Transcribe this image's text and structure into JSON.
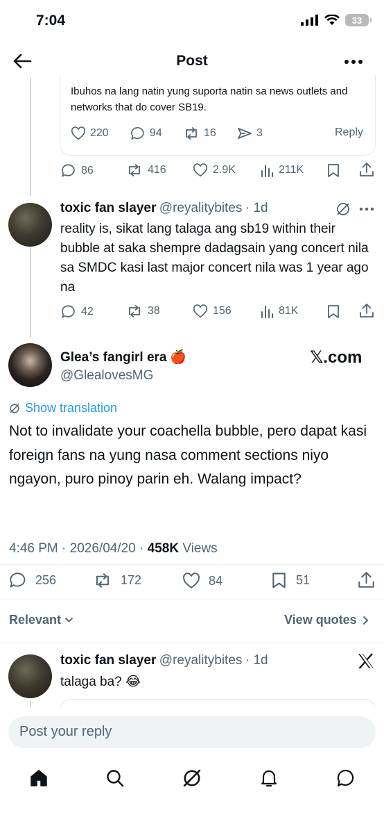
{
  "status_bar": {
    "time": "7:04",
    "battery": "33"
  },
  "header": {
    "title": "Post"
  },
  "quoted_post": {
    "text": "Ibuhos na lang natin yung suporta natin sa news outlets and networks that do cover SB19.",
    "likes": "220",
    "replies": "94",
    "reposts": "16",
    "shares": "3",
    "reply_label": "Reply"
  },
  "parent_post": {
    "replies": "86",
    "reposts": "416",
    "likes": "2.9K",
    "views": "211K"
  },
  "reply_post": {
    "name": "toxic fan slayer",
    "handle": "@reyalitybites",
    "time": "· 1d",
    "text": "reality is, sikat lang talaga ang sb19 within their bubble at saka shempre dadagsain yang concert nila sa SMDC kasi last major concert nila was 1 year ago na",
    "replies": "42",
    "reposts": "38",
    "likes": "156",
    "views": "81K"
  },
  "main_post": {
    "name": "Glea’s fangirl era",
    "emoji": "🍎",
    "handle": "@GlealovesMG",
    "watermark": "𝕏.com",
    "show_translation": "Show translation",
    "text": "Not to invalidate your coachella bubble, pero dapat kasi foreign fans na yung nasa comment sections niyo ngayon, puro pinoy parin eh. Walang impact?",
    "timestamp": "4:46 PM · 2026/04/20 · ",
    "views_count": "458K",
    "views_label": " Views",
    "replies": "256",
    "reposts": "172",
    "likes": "84",
    "bookmarks": "51"
  },
  "sort": {
    "label": "Relevant",
    "view_quotes": "View quotes"
  },
  "bottom_reply": {
    "name": "toxic fan slayer",
    "handle": "@reyalitybites",
    "time": "· 1d",
    "text": "talaga ba? 😂"
  },
  "composer": {
    "placeholder": "Post your reply"
  },
  "icons": [
    "back-arrow-icon",
    "more-icon",
    "heart-icon",
    "reply-icon",
    "repost-icon",
    "share-icon",
    "views-icon",
    "bookmark-icon",
    "grok-icon",
    "x-logo-icon",
    "home-icon",
    "search-icon",
    "bell-icon",
    "messages-icon"
  ],
  "colors": {
    "link": "#1d9bf0",
    "muted": "#536471",
    "divider": "#eff3f4"
  }
}
